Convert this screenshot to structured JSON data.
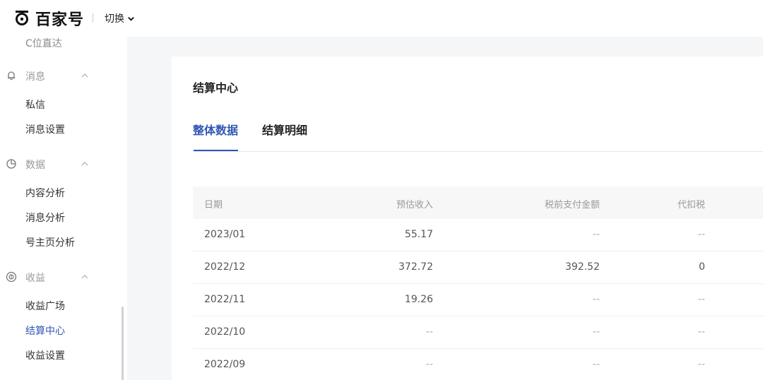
{
  "header": {
    "brand": "百家号",
    "switch_label": "切换"
  },
  "sidebar": {
    "cut_item": "C位直达",
    "groups": [
      {
        "label": "消息",
        "items": [
          "私信",
          "消息设置"
        ]
      },
      {
        "label": "数据",
        "items": [
          "内容分析",
          "消息分析",
          "号主页分析"
        ]
      },
      {
        "label": "收益",
        "items": [
          "收益广场",
          "结算中心",
          "收益设置"
        ]
      }
    ],
    "active_item": "结算中心"
  },
  "main": {
    "title": "结算中心",
    "tabs": [
      "整体数据",
      "结算明细"
    ],
    "active_tab": "整体数据",
    "table": {
      "headers": [
        "日期",
        "预估收入",
        "税前支付金额",
        "代扣税"
      ],
      "rows": [
        [
          "2023/01",
          "55.17",
          "--",
          "--"
        ],
        [
          "2022/12",
          "372.72",
          "392.52",
          "0"
        ],
        [
          "2022/11",
          "19.26",
          "--",
          "--"
        ],
        [
          "2022/10",
          "--",
          "--",
          "--"
        ],
        [
          "2022/09",
          "--",
          "--",
          "--"
        ]
      ]
    }
  },
  "colors": {
    "accent": "#2f57b5",
    "background": "#f5f6f8"
  }
}
